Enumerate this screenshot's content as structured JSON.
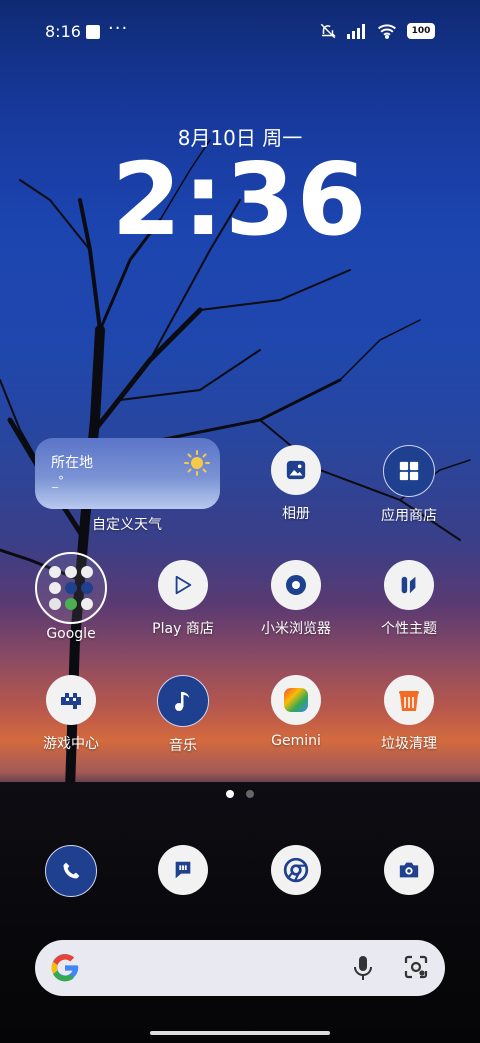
{
  "status_bar": {
    "time": "8:16",
    "more": "···",
    "battery": "100"
  },
  "lock": {
    "date": "8月10日 周一",
    "clock": "2:36"
  },
  "weather": {
    "location": "所在地",
    "temp": "_°",
    "label": "自定义天气"
  },
  "apps": {
    "album": "相册",
    "store": "应用商店",
    "google": "Google",
    "play": "Play 商店",
    "browser": "小米浏览器",
    "themes": "个性主题",
    "games": "游戏中心",
    "music": "音乐",
    "gemini": "Gemini",
    "cleaner": "垃圾清理"
  },
  "icons": {
    "status": [
      "mute-icon",
      "signal-icon",
      "wifi-icon",
      "battery-icon"
    ],
    "dock": [
      "phone-icon",
      "messages-icon",
      "chrome-icon",
      "camera-icon"
    ],
    "search": [
      "google-logo-icon",
      "mic-icon",
      "lens-icon"
    ]
  },
  "colors": {
    "accent_blue": "#1f3f8f",
    "search_bg": "#e9eaf1"
  }
}
